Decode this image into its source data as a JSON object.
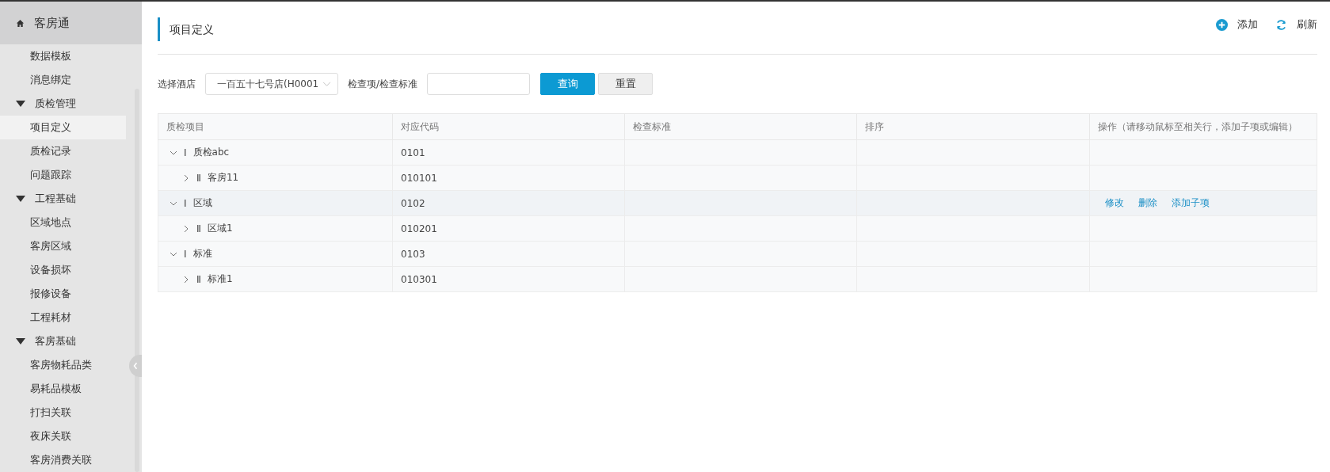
{
  "sidebar": {
    "title": "客房通",
    "items": [
      {
        "kind": "item",
        "label": "数据模板",
        "selected": false
      },
      {
        "kind": "item",
        "label": "消息绑定",
        "selected": false
      },
      {
        "kind": "group",
        "label": "质检管理",
        "expanded": true,
        "children": [
          {
            "label": "项目定义",
            "selected": true
          },
          {
            "label": "质检记录",
            "selected": false
          },
          {
            "label": "问题跟踪",
            "selected": false
          }
        ]
      },
      {
        "kind": "group",
        "label": "工程基础",
        "expanded": true,
        "children": [
          {
            "label": "区域地点",
            "selected": false
          },
          {
            "label": "客房区域",
            "selected": false
          },
          {
            "label": "设备损坏",
            "selected": false
          },
          {
            "label": "报修设备",
            "selected": false
          },
          {
            "label": "工程耗材",
            "selected": false
          }
        ]
      },
      {
        "kind": "group",
        "label": "客房基础",
        "expanded": true,
        "children": [
          {
            "label": "客房物耗品类",
            "selected": false
          },
          {
            "label": "易耗品模板",
            "selected": false
          },
          {
            "label": "打扫关联",
            "selected": false
          },
          {
            "label": "夜床关联",
            "selected": false
          },
          {
            "label": "客房消费关联",
            "selected": false
          }
        ]
      }
    ]
  },
  "page": {
    "title": "项目定义",
    "actions": [
      {
        "kind": "add",
        "label": "添加"
      },
      {
        "kind": "refresh",
        "label": "刷新"
      }
    ]
  },
  "filters": {
    "hotel_label": "选择酒店",
    "hotel_value": "一百五十七号店(H0001",
    "check_label": "检查项/检查标准",
    "query_button": "查询",
    "reset_button": "重置"
  },
  "table": {
    "columns": [
      "质检项目",
      "对应代码",
      "检查标准",
      "排序",
      "操作（请移动鼠标至相关行，添加子项或编辑）"
    ],
    "rows": [
      {
        "level": "Ⅰ",
        "name": "质检abc",
        "code": "0101",
        "expanded": true,
        "hovered": false,
        "children": [
          {
            "level": "Ⅱ",
            "name": "客房11",
            "code": "010101",
            "expanded": false
          }
        ]
      },
      {
        "level": "Ⅰ",
        "name": "区域",
        "code": "0102",
        "expanded": true,
        "hovered": true,
        "actions": [
          "修改",
          "删除",
          "添加子项"
        ],
        "children": [
          {
            "level": "Ⅱ",
            "name": "区域1",
            "code": "010201",
            "expanded": false
          }
        ]
      },
      {
        "level": "Ⅰ",
        "name": "标准",
        "code": "0103",
        "expanded": true,
        "hovered": false,
        "children": [
          {
            "level": "Ⅱ",
            "name": "标准1",
            "code": "010301",
            "expanded": false
          }
        ]
      }
    ]
  }
}
